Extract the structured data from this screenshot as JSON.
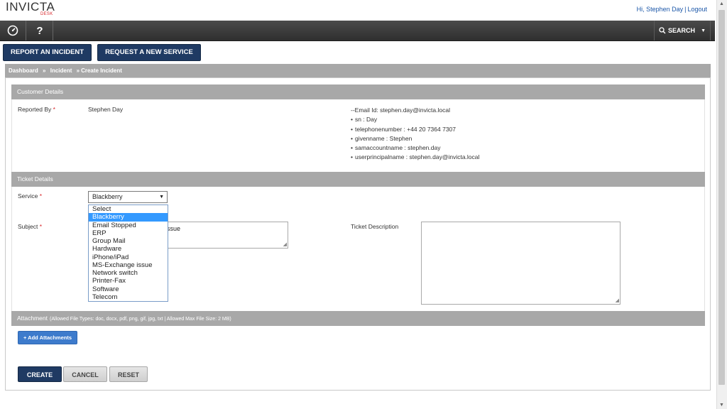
{
  "app": {
    "logo_main": "INVICTA",
    "logo_sub": "DESK",
    "greeting": "Hi, Stephen Day",
    "logout": "Logout"
  },
  "navbar": {
    "help_label": "?",
    "search_label": "SEARCH"
  },
  "actions": {
    "report_incident": "REPORT AN INCIDENT",
    "request_service": "REQUEST A NEW SERVICE"
  },
  "breadcrumb": {
    "items": [
      "Dashboard",
      "Incident",
      "Create Incident"
    ],
    "separator": "»"
  },
  "customer": {
    "header": "Customer Details",
    "reported_by_label": "Reported By",
    "reported_by_value": "Stephen Day",
    "email_line": "--Email Id: stephen.day@invicta.local",
    "attributes": [
      "sn : Day",
      "telephonenumber : +44 20 7364 7307",
      "givenname : Stephen",
      "samaccountname : stephen.day",
      "userprincipalname : stephen.day@invicta.local"
    ]
  },
  "ticket": {
    "header": "Ticket Details",
    "service_label": "Service",
    "service_value": "Blackberry",
    "service_options": [
      "Select",
      "Blackberry",
      "Email Stopped",
      "ERP",
      "Group Mail",
      "Hardware",
      "iPhone/iPad",
      "MS-Exchange issue",
      "Network switch",
      "Printer-Fax",
      "Software",
      "Telecom"
    ],
    "selected_index": 1,
    "subject_label": "Subject",
    "subject_value_partial": "ssue",
    "description_label": "Ticket Description"
  },
  "attachment": {
    "header": "Attachment",
    "note": "(Allowed File Types: doc, docx, pdf, png, gif, jpg, txt  |  Allowed Max File Size: 2 MB)",
    "add_button": "+ Add Attachments"
  },
  "form_buttons": {
    "create": "CREATE",
    "cancel": "CANCEL",
    "reset": "RESET"
  },
  "colors": {
    "primary_button": "#1f3a63",
    "section_header": "#a8a8a8",
    "required_mark": "#d9262a",
    "selected_option": "#3399ff",
    "link": "#1a56a8"
  }
}
